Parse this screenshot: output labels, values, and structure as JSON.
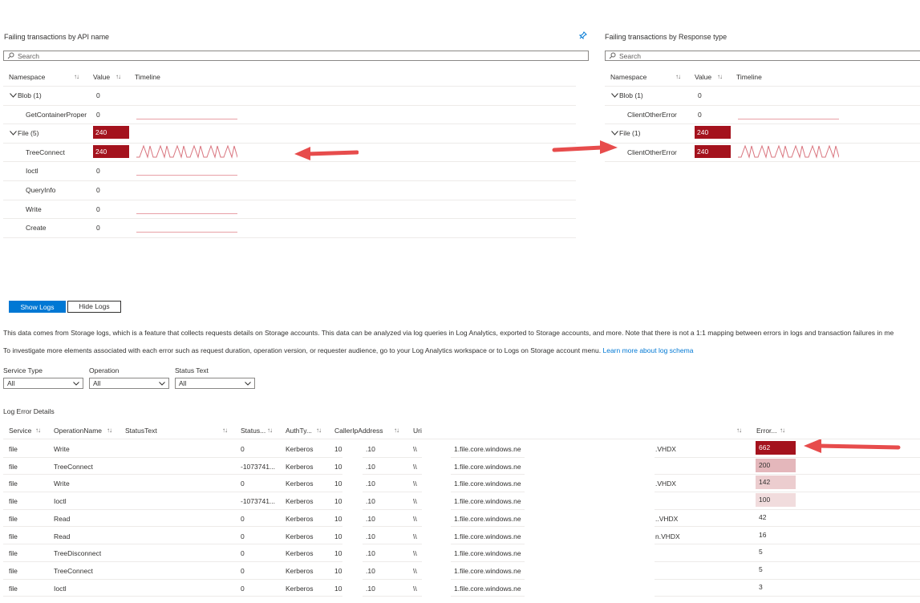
{
  "api_panel": {
    "title": "Failing transactions by API name",
    "search_placeholder": "Search",
    "headers": {
      "namespace": "Namespace",
      "value": "Value",
      "timeline": "Timeline"
    },
    "rows": [
      {
        "name": "Blob (1)",
        "value": "0",
        "group": true,
        "timeline": "none"
      },
      {
        "name": "GetContainerProper",
        "value": "0",
        "group": false,
        "timeline": "flat"
      },
      {
        "name": "File (5)",
        "value": "240",
        "group": true,
        "timeline": "none",
        "highlight": true
      },
      {
        "name": "TreeConnect",
        "value": "240",
        "group": false,
        "timeline": "spikes",
        "highlight": true
      },
      {
        "name": "Ioctl",
        "value": "0",
        "group": false,
        "timeline": "flat"
      },
      {
        "name": "QueryInfo",
        "value": "0",
        "group": false,
        "timeline": "none"
      },
      {
        "name": "Write",
        "value": "0",
        "group": false,
        "timeline": "flat"
      },
      {
        "name": "Create",
        "value": "0",
        "group": false,
        "timeline": "flat"
      }
    ]
  },
  "response_panel": {
    "title": "Failing transactions by Response type",
    "search_placeholder": "Search",
    "headers": {
      "namespace": "Namespace",
      "value": "Value",
      "timeline": "Timeline"
    },
    "rows": [
      {
        "name": "Blob (1)",
        "value": "0",
        "group": true,
        "timeline": "none"
      },
      {
        "name": "ClientOtherError",
        "value": "0",
        "group": false,
        "timeline": "flat"
      },
      {
        "name": "File (1)",
        "value": "240",
        "group": true,
        "timeline": "none",
        "highlight": true
      },
      {
        "name": "ClientOtherError",
        "value": "240",
        "group": false,
        "timeline": "spikes",
        "highlight": true
      }
    ]
  },
  "logs": {
    "show_label": "Show Logs",
    "hide_label": "Hide Logs",
    "info1": "This data comes from Storage logs, which is a feature that collects requests details on Storage accounts. This data can be analyzed via log queries in Log Analytics, exported to Storage accounts, and more. Note that there is not a 1:1 mapping between errors in logs and transaction failures in me",
    "info2_text": "To investigate more elements associated with each error such as request duration, operation version, or requester audience, go to your Log Analytics workspace or to Logs on Storage account menu.",
    "info2_link": "Learn more about log schema",
    "filters": [
      {
        "label": "Service Type",
        "value": "All"
      },
      {
        "label": "Operation",
        "value": "All"
      },
      {
        "label": "Status Text",
        "value": "All"
      }
    ],
    "section_title": "Log Error Details",
    "headers": {
      "service": "Service",
      "operation": "OperationName",
      "status_text": "StatusText",
      "status": "Status...",
      "auth": "AuthTy...",
      "caller": "CallerIpAddress",
      "uri": "Uri",
      "error": "Error..."
    },
    "rows": [
      {
        "service": "file",
        "operation": "Write",
        "status": "0",
        "auth": "Kerberos",
        "ip1": "10.",
        "ip2": ".10",
        "uri": "\\\\",
        "host": "1.file.core.windows.ne",
        "file": ".VHDX",
        "count": "662",
        "intensity": 1.0
      },
      {
        "service": "file",
        "operation": "TreeConnect",
        "status": "-1073741...",
        "auth": "Kerberos",
        "ip1": "10.",
        "ip2": ".10",
        "uri": "\\\\",
        "host": "1.file.core.windows.ne",
        "file": "",
        "count": "200",
        "intensity": 0.3
      },
      {
        "service": "file",
        "operation": "Write",
        "status": "0",
        "auth": "Kerberos",
        "ip1": "10.",
        "ip2": ".10",
        "uri": "\\\\",
        "host": "1.file.core.windows.ne",
        "file": ".VHDX",
        "count": "142",
        "intensity": 0.21
      },
      {
        "service": "file",
        "operation": "Ioctl",
        "status": "-1073741...",
        "auth": "Kerberos",
        "ip1": "10.",
        "ip2": ".10",
        "uri": "\\\\",
        "host": "1.file.core.windows.ne",
        "file": "",
        "count": "100",
        "intensity": 0.15
      },
      {
        "service": "file",
        "operation": "Read",
        "status": "0",
        "auth": "Kerberos",
        "ip1": "10.",
        "ip2": ".10",
        "uri": "\\\\",
        "host": "1.file.core.windows.ne",
        "file": "..VHDX",
        "count": "42",
        "intensity": 0
      },
      {
        "service": "file",
        "operation": "Read",
        "status": "0",
        "auth": "Kerberos",
        "ip1": "10.",
        "ip2": ".10",
        "uri": "\\\\",
        "host": "1.file.core.windows.ne",
        "file": "n.VHDX",
        "count": "16",
        "intensity": 0
      },
      {
        "service": "file",
        "operation": "TreeDisconnect",
        "status": "0",
        "auth": "Kerberos",
        "ip1": "10.",
        "ip2": ".10",
        "uri": "\\\\",
        "host": "1.file.core.windows.ne",
        "file": "",
        "count": "5",
        "intensity": 0
      },
      {
        "service": "file",
        "operation": "TreeConnect",
        "status": "0",
        "auth": "Kerberos",
        "ip1": "10.",
        "ip2": ".10",
        "uri": "\\\\",
        "host": "1.file.core.windows.ne",
        "file": "",
        "count": "5",
        "intensity": 0
      },
      {
        "service": "file",
        "operation": "Ioctl",
        "status": "0",
        "auth": "Kerberos",
        "ip1": "10.",
        "ip2": ".10",
        "uri": "\\\\",
        "host": "1.file.core.windows.ne",
        "file": "",
        "count": "3",
        "intensity": 0
      }
    ]
  },
  "colors": {
    "accent": "#0078d4",
    "error_red": "#a4121d",
    "arrow_red": "#e74c4c"
  }
}
